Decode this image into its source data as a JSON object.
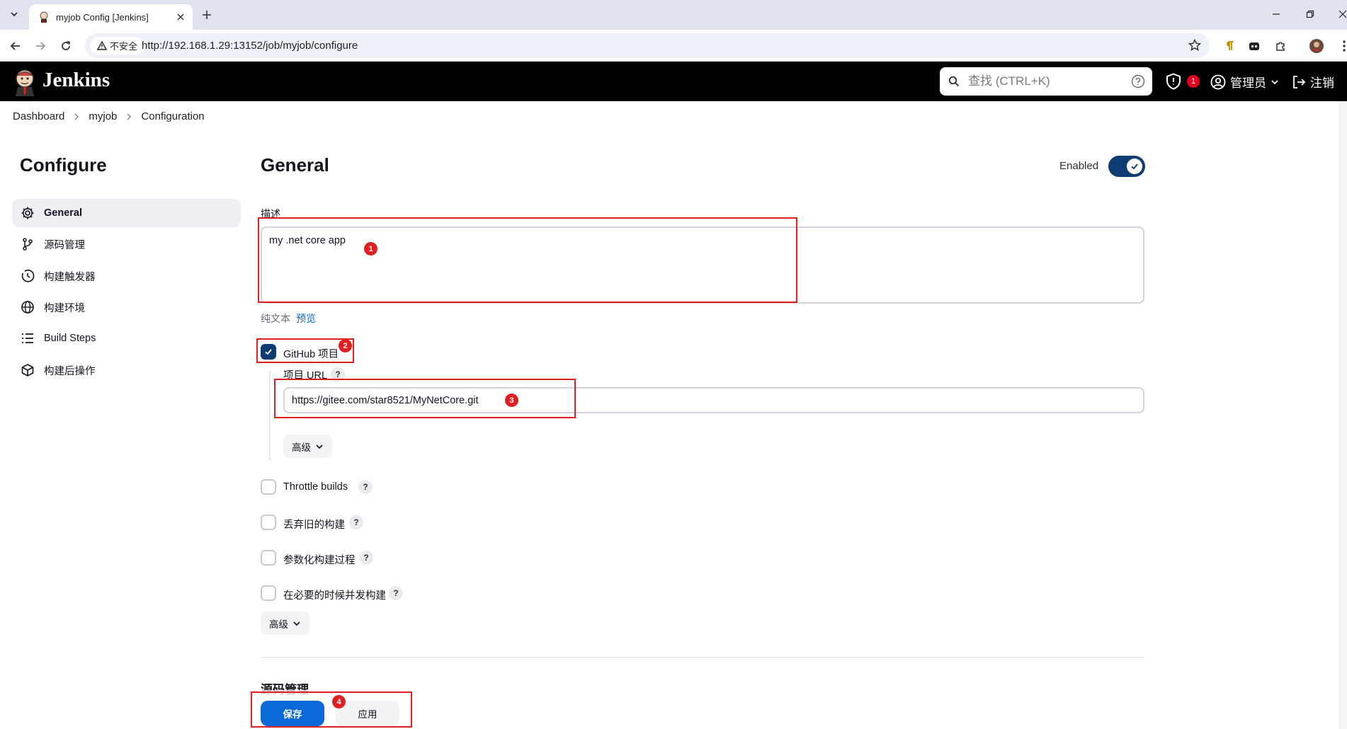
{
  "browser": {
    "tab_title": "myjob Config [Jenkins]",
    "security_label": "不安全",
    "url": "http://192.168.1.29:13152/job/myjob/configure"
  },
  "header": {
    "brand": "Jenkins",
    "search_placeholder": "查找 (CTRL+K)",
    "security_badge": "1",
    "user_label": "管理员",
    "logout_label": "注销"
  },
  "breadcrumb": [
    "Dashboard",
    "myjob",
    "Configuration"
  ],
  "sidebar": {
    "title": "Configure",
    "items": [
      {
        "label": "General",
        "icon": "gear-icon"
      },
      {
        "label": "源码管理",
        "icon": "branch-icon"
      },
      {
        "label": "构建触发器",
        "icon": "clock-icon"
      },
      {
        "label": "构建环境",
        "icon": "globe-icon"
      },
      {
        "label": "Build Steps",
        "icon": "list-icon"
      },
      {
        "label": "构建后操作",
        "icon": "box-icon"
      }
    ]
  },
  "main": {
    "section_title": "General",
    "enabled_label": "Enabled",
    "enabled": true,
    "description_label": "描述",
    "description_value": "my .net core app",
    "plain_text_label": "纯文本",
    "preview_label": "预览",
    "github_project_label": "GitHub 项目",
    "github_project_checked": true,
    "project_url_label": "项目 URL",
    "project_url_value": "https://gitee.com/star8521/MyNetCore.git",
    "advanced_label": "高级",
    "options": [
      {
        "label": "Throttle builds",
        "checked": false
      },
      {
        "label": "丢弃旧的构建",
        "checked": false
      },
      {
        "label": "参数化构建过程",
        "checked": false
      },
      {
        "label": "在必要的时候并发构建",
        "checked": false
      }
    ],
    "advanced_label_2": "高级",
    "next_section_title": "源码管理",
    "help_glyph": "?"
  },
  "actions": {
    "save_label": "保存",
    "apply_label": "应用"
  },
  "annotations": [
    "1",
    "2",
    "3",
    "4"
  ],
  "colors": {
    "accent": "#0b6ad8",
    "toggle": "#0f3c73",
    "annotation": "#e02020"
  }
}
